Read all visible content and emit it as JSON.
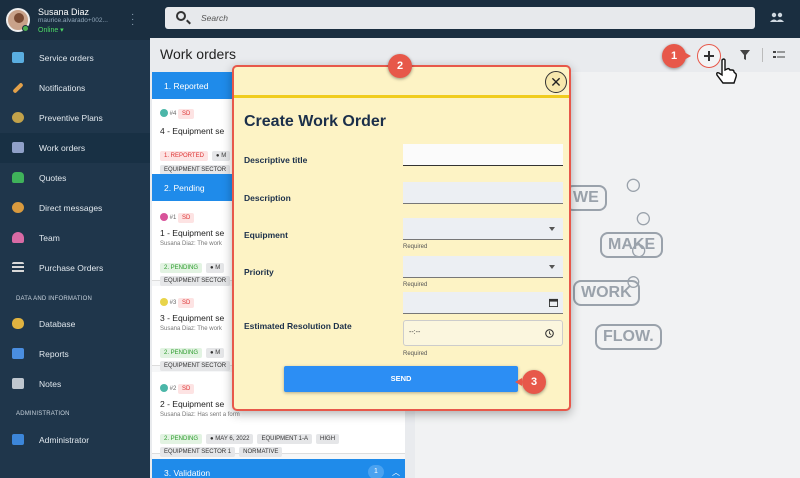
{
  "profile": {
    "name": "Susana Diaz",
    "email": "maurice.alvarado+002...",
    "status": "Online ▾"
  },
  "nav": {
    "items": [
      {
        "label": "Service orders",
        "icon": "briefcase-icon",
        "color": "#5aaee0"
      },
      {
        "label": "Notifications",
        "icon": "wrench-icon",
        "color": "#e3a14a"
      },
      {
        "label": "Preventive Plans",
        "icon": "calendar-icon",
        "color": "#c2a24a"
      },
      {
        "label": "Work orders",
        "icon": "toolbox-icon",
        "color": "#8fa0c8"
      },
      {
        "label": "Quotes",
        "icon": "money-bag-icon",
        "color": "#3fb25a"
      },
      {
        "label": "Direct messages",
        "icon": "chat-icon",
        "color": "#d99a3e"
      },
      {
        "label": "Team",
        "icon": "team-icon",
        "color": "#d86aa4"
      },
      {
        "label": "Purchase Orders",
        "icon": "sliders-icon",
        "color": "#d9d9d9"
      }
    ],
    "section_data": "DATA AND INFORMATION",
    "data_items": [
      {
        "label": "Database",
        "icon": "database-icon",
        "color": "#e0b340"
      },
      {
        "label": "Reports",
        "icon": "reports-icon",
        "color": "#4a8ee0"
      },
      {
        "label": "Notes",
        "icon": "folder-icon",
        "color": "#bfc7cf"
      }
    ],
    "section_admin": "ADMINISTRATION",
    "admin_items": [
      {
        "label": "Administrator",
        "icon": "admin-icon",
        "color": "#3c86d9"
      }
    ]
  },
  "search": {
    "placeholder": "Search"
  },
  "page": {
    "title": "Work orders"
  },
  "groups": {
    "reported": "1. Reported",
    "pending": "2. Pending",
    "validation": "3. Validation",
    "validation_count": "1"
  },
  "cards": [
    {
      "num": "#4",
      "user": "SD",
      "title": "4 - Equipment se",
      "comment": "",
      "tags": [
        "1. REPORTED",
        "● M"
      ],
      "tags2": [
        "EQUIPMENT SECTOR"
      ]
    },
    {
      "num": "#1",
      "user": "SD",
      "title": "1 - Equipment se",
      "comment": "Susana Diaz: The work",
      "tags": [
        "2. PENDING",
        "● M"
      ],
      "tags2": [
        "EQUIPMENT SECTOR"
      ]
    },
    {
      "num": "#3",
      "user": "SD",
      "title": "3 - Equipment se",
      "comment": "Susana Diaz: The work",
      "tags": [
        "2. PENDING",
        "● M"
      ],
      "tags2": [
        "EQUIPMENT SECTOR"
      ]
    },
    {
      "num": "#2",
      "user": "SD",
      "title": "2 - Equipment se",
      "comment": "Susana Diaz: Has sent a form",
      "tags": [
        "2. PENDING",
        "● MAY 6, 2022",
        "EQUIPMENT 1-A",
        "HIGH"
      ],
      "tags2": [
        "EQUIPMENT SECTOR 1",
        "NORMATIVE"
      ]
    }
  ],
  "illustration": {
    "w1": "WE",
    "w2": "MAKE",
    "w3": "WORK",
    "w4": "FLOW."
  },
  "modal": {
    "title": "Create Work Order",
    "fields": {
      "title_label": "Descriptive title",
      "description_label": "Description",
      "equipment_label": "Equipment",
      "priority_label": "Priority",
      "date_label": "Estimated Resolution Date",
      "time_placeholder": "--:--",
      "required": "Required"
    },
    "send": "SEND",
    "close": "✕"
  },
  "steps": {
    "s1": "1",
    "s2": "2",
    "s3": "3"
  },
  "colors": {
    "accent": "#1f8bea",
    "step": "#e7584a",
    "modal_bg": "#fdf3c5",
    "sidebar": "#1f364b"
  }
}
